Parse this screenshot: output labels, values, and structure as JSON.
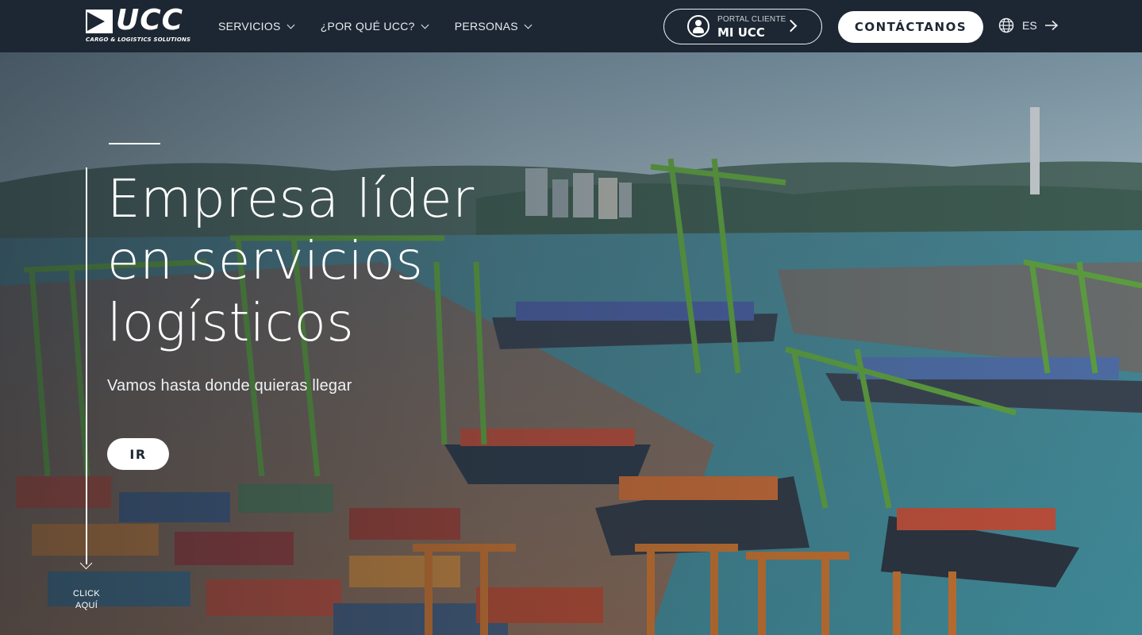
{
  "header": {
    "logo": {
      "letters": "UCC",
      "tagline": "CARGO & LOGISTICS SOLUTIONS"
    },
    "nav": [
      {
        "label": "SERVICIOS"
      },
      {
        "label": "¿POR QUÉ UCC?"
      },
      {
        "label": "PERSONAS"
      }
    ],
    "portal": {
      "small": "PORTAL CLIENTE",
      "big": "MI UCC"
    },
    "contact_label": "CONTÁCTANOS",
    "language": "ES"
  },
  "hero": {
    "title": "Empresa líder en servicios logísticos",
    "subtitle": "Vamos hasta donde quieras llegar",
    "cta_label": "IR",
    "scroll_label": "CLICK AQUÍ"
  },
  "colors": {
    "header_bg": "#1d2733",
    "text": "#ffffff",
    "crane_green": "#5fa340",
    "crane_orange": "#c8722e",
    "water": "#4f8f9c"
  },
  "icons": [
    "logo-mark",
    "chevron-down-icon",
    "user-circle-icon",
    "chevron-right-icon",
    "globe-icon",
    "arrow-right-icon",
    "arrow-down-icon"
  ]
}
